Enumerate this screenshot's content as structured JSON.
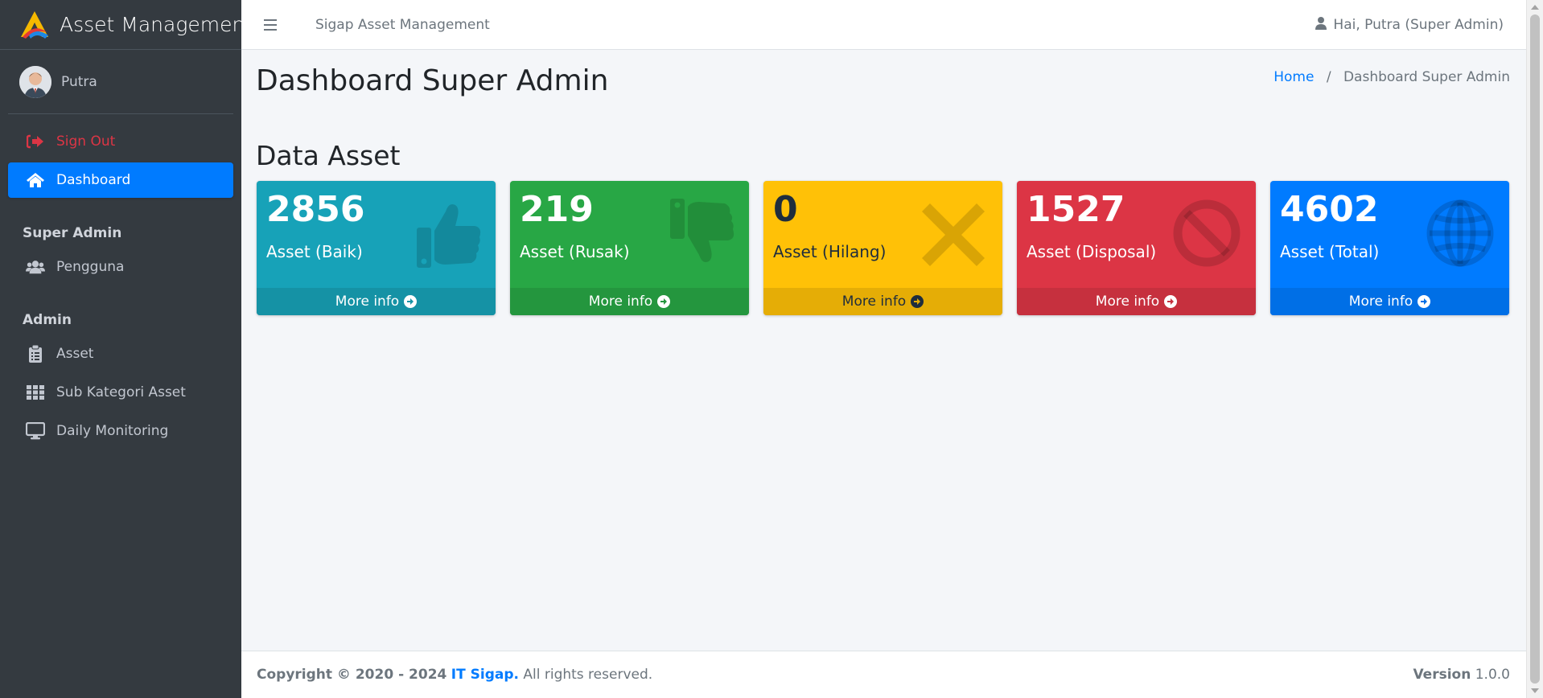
{
  "sidebar": {
    "brand": "Asset Managemen",
    "user_name": "Putra",
    "items": [
      {
        "label": "Sign Out",
        "icon": "sign-out-icon"
      },
      {
        "label": "Dashboard",
        "icon": "home-icon"
      }
    ],
    "sections": [
      {
        "header": "Super Admin",
        "items": [
          {
            "label": "Pengguna",
            "icon": "users-icon"
          }
        ]
      },
      {
        "header": "Admin",
        "items": [
          {
            "label": "Asset",
            "icon": "clipboard-icon"
          },
          {
            "label": "Sub Kategori Asset",
            "icon": "grid-icon"
          },
          {
            "label": "Daily Monitoring",
            "icon": "monitor-icon"
          }
        ]
      }
    ]
  },
  "topbar": {
    "title": "Sigap Asset Management",
    "user": "Hai, Putra (Super Admin)"
  },
  "page": {
    "title": "Dashboard Super Admin",
    "breadcrumb": {
      "home": "Home",
      "sep": "/",
      "current": "Dashboard Super Admin"
    },
    "section_title": "Data Asset"
  },
  "boxes": [
    {
      "value": "2856",
      "label": "Asset (Baik)",
      "more": "More info",
      "color": "#17a2b8",
      "footer_color": "#1592a5",
      "icon": "thumbs-up-icon"
    },
    {
      "value": "219",
      "label": "Asset (Rusak)",
      "more": "More info",
      "color": "#28a745",
      "footer_color": "#24963e",
      "icon": "thumbs-down-icon"
    },
    {
      "value": "0",
      "label": "Asset (Hilang)",
      "more": "More info",
      "color": "#ffc107",
      "footer_color": "#e5ad06",
      "icon": "times-icon"
    },
    {
      "value": "1527",
      "label": "Asset (Disposal)",
      "more": "More info",
      "color": "#dc3545",
      "footer_color": "#c6303e",
      "icon": "ban-icon"
    },
    {
      "value": "4602",
      "label": "Asset (Total)",
      "more": "More info",
      "color": "#007bff",
      "footer_color": "#006fe6",
      "icon": "globe-icon"
    }
  ],
  "footer": {
    "copyright": "Copyright © 2020 - 2024",
    "link": "IT Sigap.",
    "rights": "All rights reserved.",
    "version_label": "Version",
    "version": "1.0.0"
  }
}
